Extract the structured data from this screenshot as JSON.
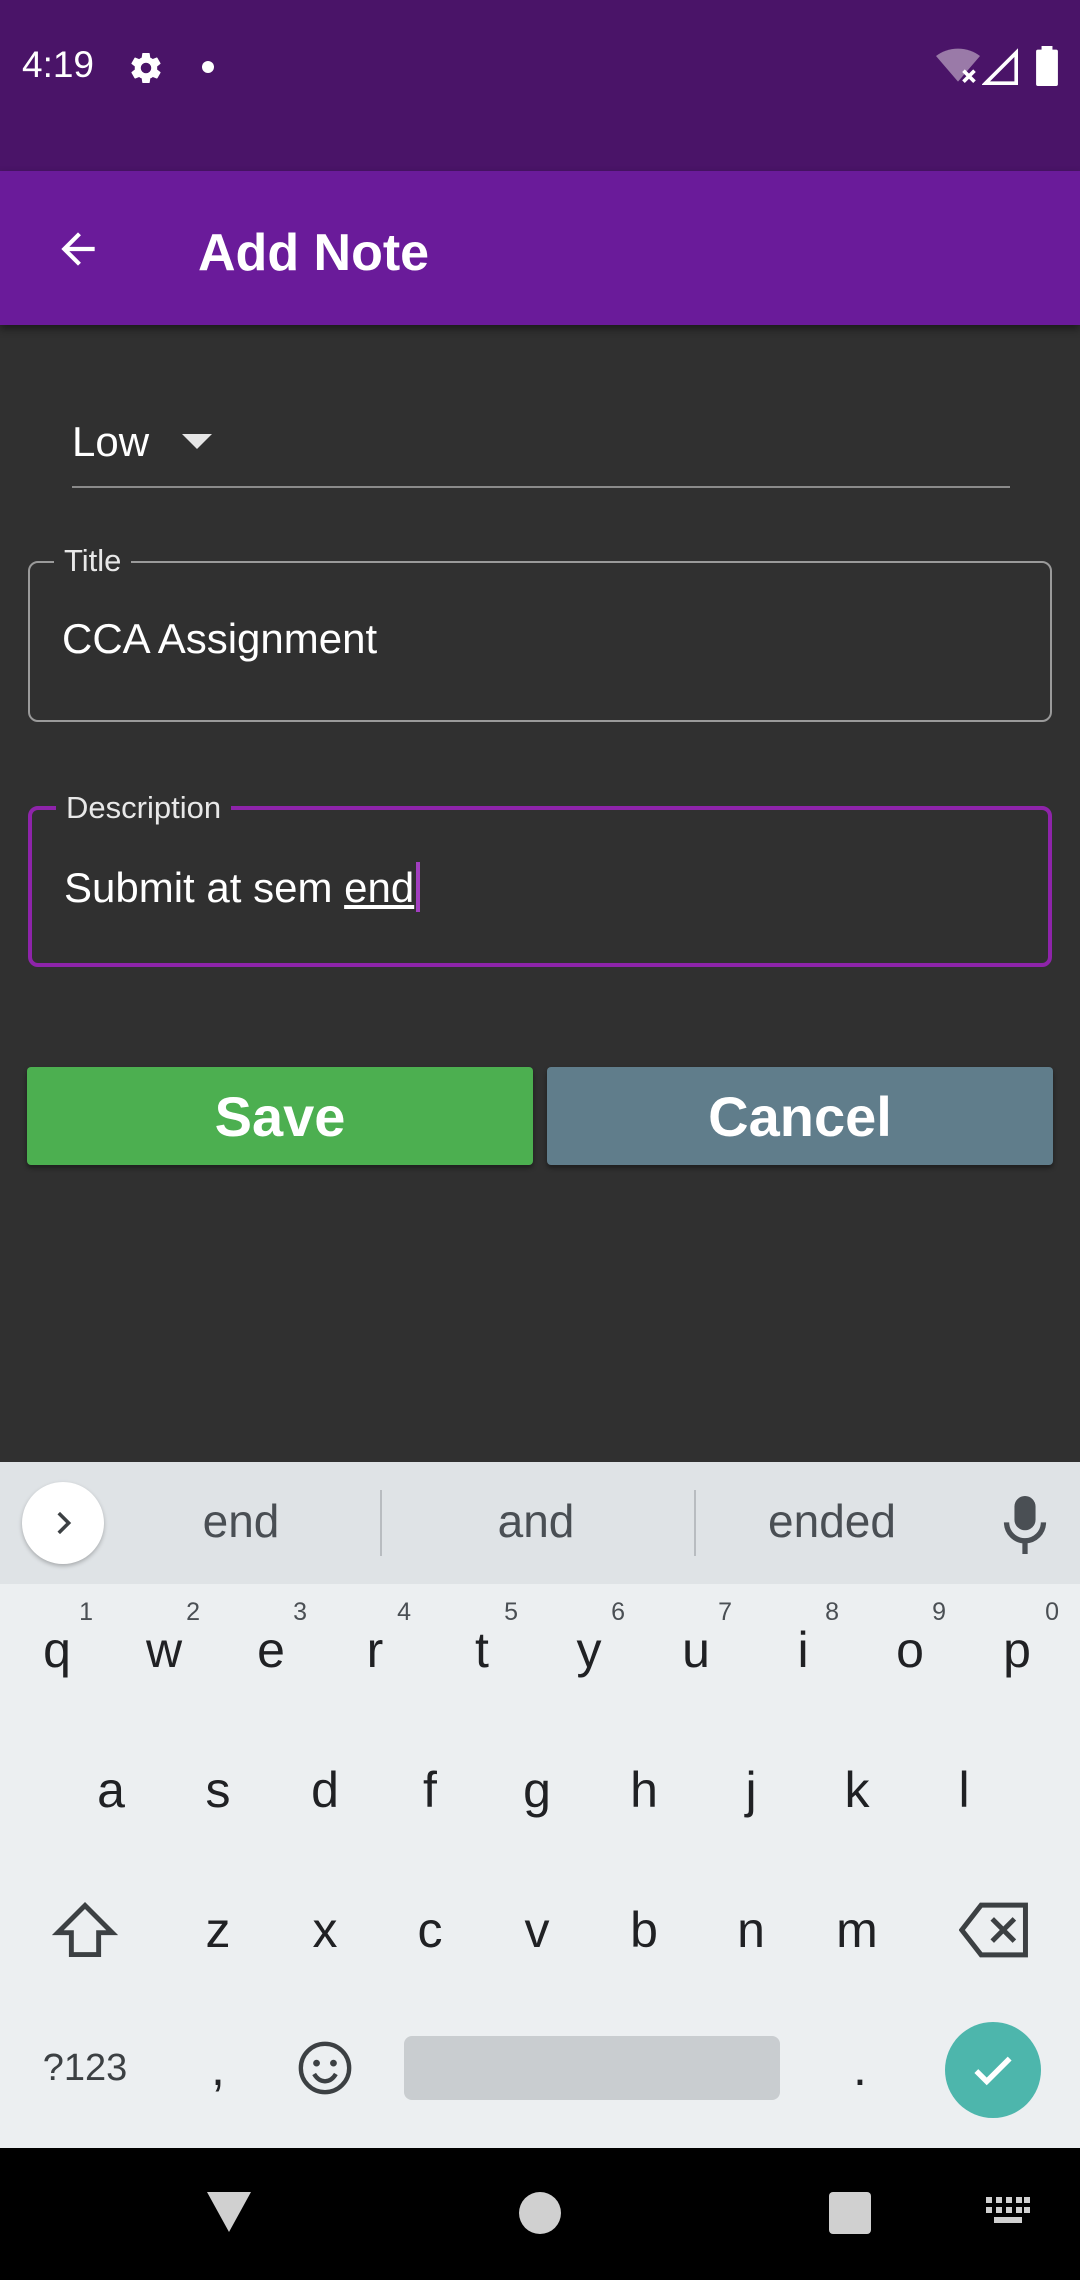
{
  "status_bar": {
    "time": "4:19",
    "icons": [
      "gear-icon",
      "notification-dot-icon",
      "wifi-off-icon",
      "cell-signal-icon",
      "battery-icon"
    ]
  },
  "app_bar": {
    "title": "Add Note",
    "back_icon": "arrow-back-icon",
    "color": "#6a1b9a"
  },
  "form": {
    "priority": {
      "value": "Low"
    },
    "title_field": {
      "label": "Title",
      "value": "CCA Assignment"
    },
    "description_field": {
      "label": "Description",
      "value_prefix": "Submit at sem ",
      "value_composing": "end",
      "focused_color": "#8e24aa"
    }
  },
  "buttons": {
    "save": {
      "label": "Save",
      "color": "#4caf50"
    },
    "cancel": {
      "label": "Cancel",
      "color": "#607d8b"
    }
  },
  "keyboard": {
    "suggestions": [
      "end",
      "and",
      "ended"
    ],
    "row1": [
      {
        "key": "q",
        "hint": "1"
      },
      {
        "key": "w",
        "hint": "2"
      },
      {
        "key": "e",
        "hint": "3"
      },
      {
        "key": "r",
        "hint": "4"
      },
      {
        "key": "t",
        "hint": "5"
      },
      {
        "key": "y",
        "hint": "6"
      },
      {
        "key": "u",
        "hint": "7"
      },
      {
        "key": "i",
        "hint": "8"
      },
      {
        "key": "o",
        "hint": "9"
      },
      {
        "key": "p",
        "hint": "0"
      }
    ],
    "row2": [
      "a",
      "s",
      "d",
      "f",
      "g",
      "h",
      "j",
      "k",
      "l"
    ],
    "row3": [
      "z",
      "x",
      "c",
      "v",
      "b",
      "n",
      "m"
    ],
    "symbols_key": "?123",
    "comma_key": ",",
    "period_key": ".",
    "enter_color": "#4db6ac"
  },
  "nav_bar": {
    "icons": [
      "nav-back-icon",
      "nav-home-icon",
      "nav-recents-icon",
      "keyboard-switch-icon"
    ]
  }
}
